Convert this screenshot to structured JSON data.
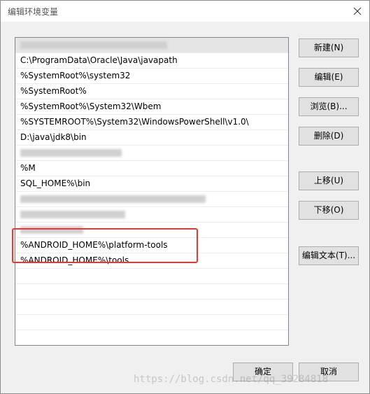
{
  "window": {
    "title": "编辑环境变量"
  },
  "list": {
    "rows": [
      {
        "text": "",
        "blurred": true,
        "blur_width": 210,
        "selected": true
      },
      {
        "text": "C:\\ProgramData\\Oracle\\Java\\javapath",
        "blurred": false
      },
      {
        "text": "%SystemRoot%\\system32",
        "blurred": false
      },
      {
        "text": "%SystemRoot%",
        "blurred": false
      },
      {
        "text": "%SystemRoot%\\System32\\Wbem",
        "blurred": false
      },
      {
        "text": "%SYSTEMROOT%\\System32\\WindowsPowerShell\\v1.0\\",
        "blurred": false
      },
      {
        "text": "D:\\java\\jdk8\\bin",
        "blurred": false
      },
      {
        "text": "",
        "blurred": true,
        "blur_width": 145
      },
      {
        "text": "%M",
        "blurred": false
      },
      {
        "text": "SQL_HOME%\\bin",
        "blurred": false
      },
      {
        "text": "",
        "blurred": true,
        "blur_width": 265
      },
      {
        "text": "",
        "blurred": true,
        "blur_width": 150
      },
      {
        "text": "",
        "blurred": true,
        "blur_width": 90
      },
      {
        "text": "%ANDROID_HOME%\\platform-tools",
        "blurred": false
      },
      {
        "text": "%ANDROID_HOME%\\tools",
        "blurred": false
      },
      {
        "text": "",
        "blurred": false
      },
      {
        "text": "",
        "blurred": false
      },
      {
        "text": "",
        "blurred": false
      },
      {
        "text": "",
        "blurred": false
      },
      {
        "text": "",
        "blurred": false
      },
      {
        "text": "",
        "blurred": false
      }
    ]
  },
  "buttons": {
    "new": "新建(N)",
    "edit": "编辑(E)",
    "browse": "浏览(B)...",
    "delete": "删除(D)",
    "move_up": "上移(U)",
    "move_down": "下移(O)",
    "edit_text": "编辑文本(T)...",
    "ok": "确定",
    "cancel": "取消"
  },
  "watermark": "https://blog.csdn.net/qq_39284818",
  "colors": {
    "highlight": "#e53a33"
  }
}
